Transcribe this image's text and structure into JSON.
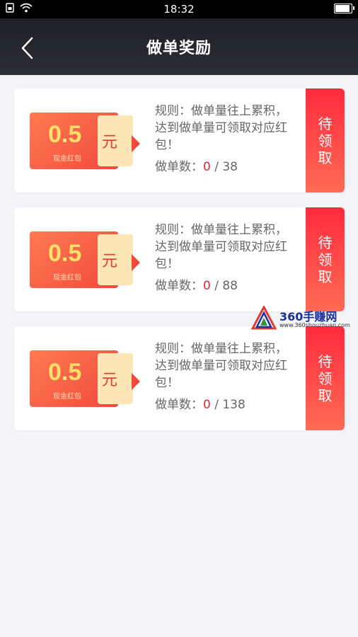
{
  "status_bar": {
    "time": "18:32"
  },
  "header": {
    "title": "做单奖励"
  },
  "cards": [
    {
      "amount": "0.5",
      "unit": "元",
      "subtitle": "现金红包",
      "rule": "规则：做单量往上累积，达到做单量可领取对应红包！",
      "progress_label": "做单数：",
      "progress_current": "0",
      "progress_total": "/ 38",
      "claim_label": [
        "待",
        "领",
        "取"
      ]
    },
    {
      "amount": "0.5",
      "unit": "元",
      "subtitle": "现金红包",
      "rule": "规则：做单量往上累积，达到做单量可领取对应红包！",
      "progress_label": "做单数：",
      "progress_current": "0",
      "progress_total": "/ 88",
      "claim_label": [
        "待",
        "领",
        "取"
      ]
    },
    {
      "amount": "0.5",
      "unit": "元",
      "subtitle": "现金红包",
      "rule": "规则：做单量往上累积，达到做单量可领取对应红包！",
      "progress_label": "做单数：",
      "progress_current": "0",
      "progress_total": "/ 138",
      "claim_label": [
        "待",
        "领",
        "取"
      ]
    }
  ],
  "watermark": {
    "name": "360手赚网",
    "url": "www.360shouzhuan.com"
  },
  "colors": {
    "header_bg": "#23242b",
    "accent_red": "#ff2b3e",
    "coupon_red": "#f0493b",
    "coupon_gold": "#fce16a"
  }
}
